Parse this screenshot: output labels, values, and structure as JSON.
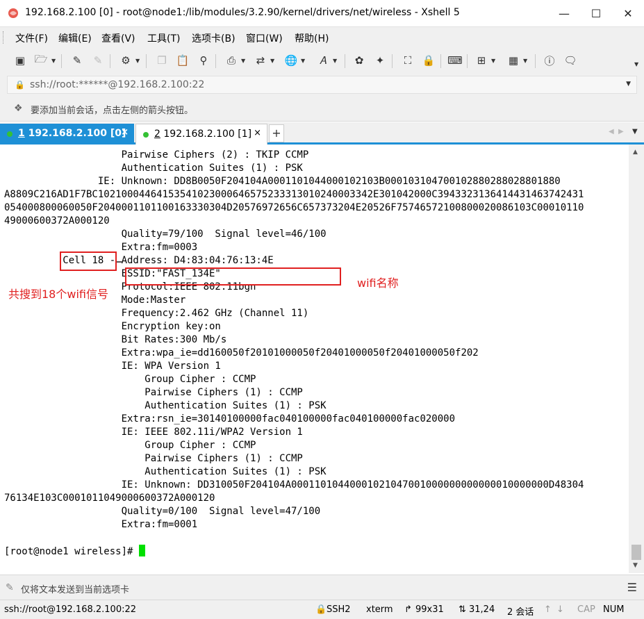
{
  "window": {
    "title": "192.168.2.100 [0] - root@node1:/lib/modules/3.2.90/kernel/drivers/net/wireless - Xshell 5",
    "controls": [
      "minimize-icon",
      "maximize-icon",
      "close-icon"
    ]
  },
  "menu": [
    "文件(F)",
    "编辑(E)",
    "查看(V)",
    "工具(T)",
    "选项卡(B)",
    "窗口(W)",
    "帮助(H)"
  ],
  "toolbar_icons": [
    "new-session-icon",
    "open-folder-icon",
    "reconnect-icon",
    "disconnect-icon",
    "properties-icon",
    "copy-icon",
    "paste-icon",
    "find-icon",
    "print-icon",
    "transfer-icon",
    "globe-icon",
    "font-icon",
    "xftp-icon",
    "xmanager-icon",
    "fullscreen-icon",
    "lock-icon",
    "keyboard-icon",
    "compose-icon",
    "layout-icon",
    "help-icon",
    "chat-icon"
  ],
  "address": {
    "value": "ssh://root:******@192.168.2.100:22"
  },
  "hint": {
    "text": "要添加当前会话，点击左侧的箭头按钮。"
  },
  "tabs": [
    {
      "num": "1",
      "label": "192.168.2.100 [0]",
      "close": "×",
      "active": true
    },
    {
      "num": "2",
      "label": "192.168.2.100 [1]",
      "close": "×",
      "active": false
    }
  ],
  "tab_add": "+",
  "terminal": {
    "lines": [
      "                    Pairwise Ciphers (2) : TKIP CCMP",
      "                    Authentication Suites (1) : PSK",
      "                IE: Unknown: DD8B0050F204104A000110104400010210​3B00010310470010288028802880188​0",
      "A8809C216AD1F7BC1021000446415354102300064657523331301024000​3342E301042000C394332313641443146374243​1",
      "054000800060050F204000110110016333030​4D20576972656C657373204E20526F7574657210​0800020086103C00010110",
      "49000600372A000120",
      "                    Quality=79/100  Signal level=46/100",
      "                    Extra:fm=0003",
      "          Cell 18 - Address: D4:83:04:76:13:4E",
      "                    ESSID:\"FAST_134E\"",
      "                    Protocol:IEEE 802.11bgn",
      "                    Mode:Master",
      "                    Frequency:2.462 GHz (Channel 11)",
      "                    Encryption key:on",
      "                    Bit Rates:300 Mb/s",
      "                    Extra:wpa_ie=dd160050f20101000050f20401000050f20401000050f202",
      "                    IE: WPA Version 1",
      "                        Group Cipher : CCMP",
      "                        Pairwise Ciphers (1) : CCMP",
      "                        Authentication Suites (1) : PSK",
      "                    Extra:rsn_ie=30140100000fac040100000fac040100000fac020000",
      "                    IE: IEEE 802.11i/WPA2 Version 1",
      "                        Group Cipher : CCMP",
      "                        Pairwise Ciphers (1) : CCMP",
      "                        Authentication Suites (1) : PSK",
      "                    IE: Unknown: DD310050F204104A00011010440001021047001000000000000010000000D48304",
      "76134E103C0001011049000600372A000120",
      "                    Quality=0/100  Signal level=47/100",
      "                    Extra:fm=0001",
      "",
      "[root@node1 wireless]# "
    ]
  },
  "annotations": {
    "cell_label": "共搜到18个wifi信号",
    "essid_label": "wifi名称"
  },
  "compose": {
    "text": "仅将文本发送到当前选项卡"
  },
  "status": {
    "connection": "ssh://root@192.168.2.100:22",
    "protocol": "SSH2",
    "terminal_type": "xterm",
    "size": "99x31",
    "cursor": "31,24",
    "sessions": "2 会话",
    "cap": "CAP",
    "num": "NUM"
  },
  "colors": {
    "tab_active": "#1e90d6",
    "cursor": "#00e000",
    "annotation": "#e02020"
  }
}
